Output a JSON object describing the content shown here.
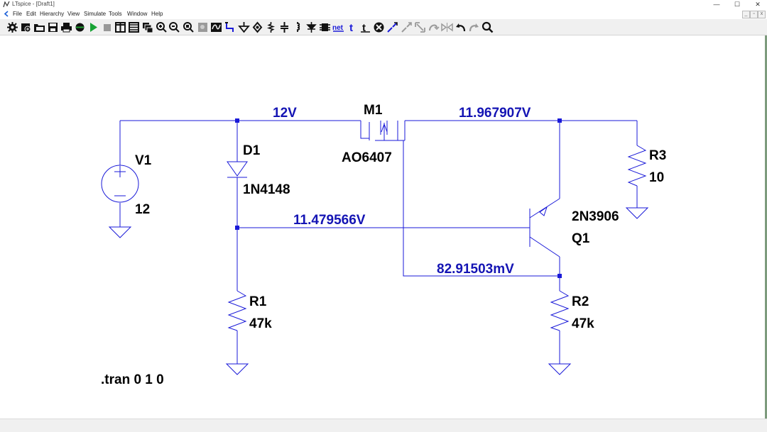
{
  "window": {
    "title": "LTspice - [Draft1]",
    "minimize_glyph": "—",
    "maximize_glyph": "☐",
    "close_glyph": "✕"
  },
  "menu": {
    "items": [
      "File",
      "Edit",
      "Hierarchy",
      "View",
      "Simulate",
      "Tools",
      "Window",
      "Help"
    ]
  },
  "mdi_controls": [
    "_",
    "▫",
    "x"
  ],
  "toolbar": {
    "icons": [
      "settings-icon",
      "open-file-icon",
      "open-folder-icon",
      "save-icon",
      "print-icon",
      "control-panel-icon",
      "run-icon",
      "halt-icon",
      "tile-vertical-icon",
      "tile-horizontal-icon",
      "cascade-icon",
      "zoom-in-icon",
      "zoom-out-icon",
      "zoom-fit-icon",
      "zoom-back-icon",
      "autorange-icon",
      "draw-wire-icon",
      "ground-icon",
      "label-net-icon",
      "resistor-icon",
      "capacitor-icon",
      "inductor-icon",
      "diode-icon",
      "component-icon",
      "spice-directive-icon",
      "text-icon",
      "move-icon",
      "delete-icon",
      "copy-icon",
      "drag-icon",
      "rotate-icon",
      "mirror-icon",
      "undo-icon",
      "redo-icon",
      "find-icon"
    ]
  },
  "schematic": {
    "components": {
      "v1": {
        "name": "V1",
        "value": "12"
      },
      "d1": {
        "name": "D1",
        "value": "1N4148"
      },
      "m1": {
        "name": "M1",
        "value": "AO6407"
      },
      "r1": {
        "name": "R1",
        "value": "47k"
      },
      "r2": {
        "name": "R2",
        "value": "47k"
      },
      "r3": {
        "name": "R3",
        "value": "10"
      },
      "q1": {
        "name": "Q1",
        "value": "2N3906"
      }
    },
    "node_voltages": {
      "supply": "12V",
      "drain": "11.967907V",
      "base": "11.479566V",
      "gate": "82.91503mV"
    },
    "directive": ".tran 0 1 0"
  },
  "colors": {
    "wire": "#1a1ad8",
    "node_voltage_label": "#1414b4",
    "component_label": "#000000",
    "junction": "#1a1ad8",
    "toolbar_bg": "#f0f0f0"
  }
}
